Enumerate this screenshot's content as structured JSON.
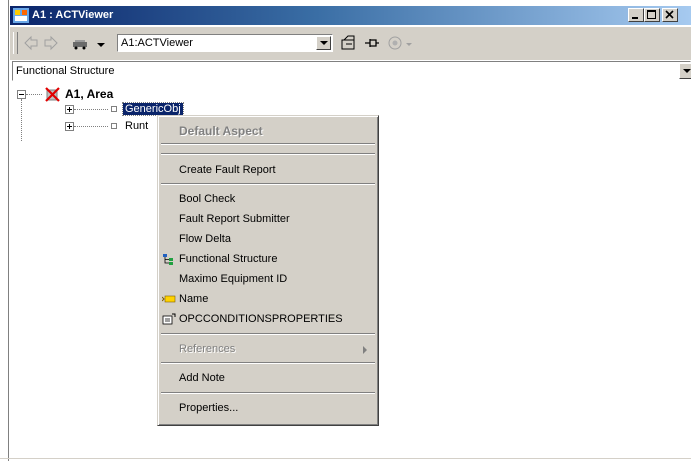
{
  "window": {
    "title": "A1 : ACTViewer"
  },
  "toolbar": {
    "path_value": "A1:ACTViewer"
  },
  "structure_selector": {
    "value": "Functional Structure"
  },
  "tree": {
    "root": {
      "label": "A1, Area"
    },
    "children": [
      {
        "label": "GenericObj"
      },
      {
        "label": "Runt"
      }
    ]
  },
  "context_menu": {
    "header": "Default Aspect",
    "create_fault_report": "Create Fault Report",
    "bool_check": "Bool Check",
    "fault_report_submitter": "Fault Report Submitter",
    "flow_delta": "Flow Delta",
    "functional_structure": "Functional Structure",
    "maximo_equipment_id": "Maximo Equipment ID",
    "name": "Name",
    "opc_condition_properties": "OPCCONDITIONSPROPERTIES",
    "references": "References",
    "add_note": "Add Note",
    "properties": "Properties..."
  },
  "colors": {
    "title_bar": "#0a246a",
    "selection": "#0a246a",
    "menu_bg": "#d4d0c8"
  }
}
